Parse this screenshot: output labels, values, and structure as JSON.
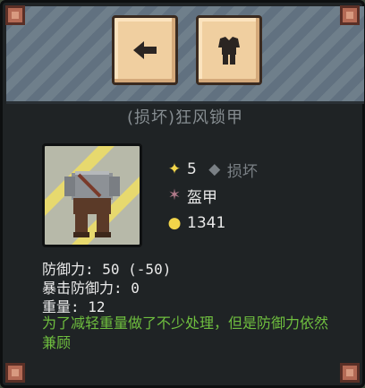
{
  "item": {
    "title": "(损坏)狂风锁甲",
    "level": "5",
    "condition": "损坏",
    "type": "盔甲",
    "price": "1341",
    "defense": "防御力: 50 (-50)",
    "crit_defense": "暴击防御力: 0",
    "weight": "重量: 12",
    "description": "为了减轻重量做了不少处理，但是防御力依然兼顾"
  },
  "icons": {
    "back": "left-arrow-icon",
    "armor_tab": "armor-icon",
    "level": "star-icon",
    "condition": "diamond-icon",
    "type": "crossed-weapons-icon",
    "price": "gold-coin-icon"
  },
  "colors": {
    "panel": "#1f2325",
    "button": "#f0cfa0",
    "description": "#6fbf3f",
    "title": "#868d91",
    "gold": "#f2d54a"
  }
}
